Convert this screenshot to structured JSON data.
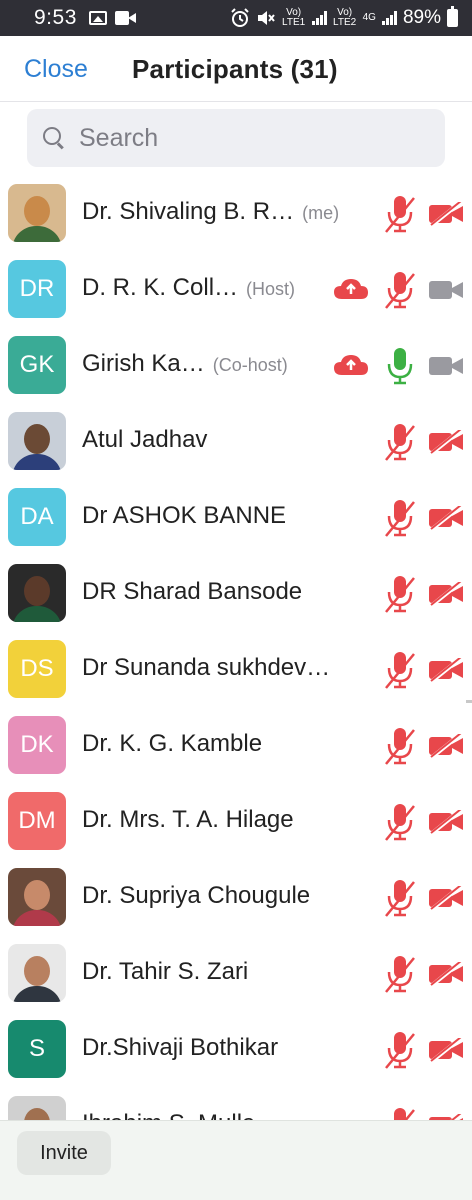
{
  "status_bar": {
    "time": "9:53",
    "network_1": "Vo) LTE1",
    "network_2": "Vo) LTE2",
    "network_type": "4G",
    "battery": "89%",
    "icons": [
      "gallery-icon",
      "video-camera-icon",
      "alarm-icon",
      "mute-icon",
      "signal-icon",
      "battery-icon"
    ]
  },
  "header": {
    "close_label": "Close",
    "title": "Participants (31)"
  },
  "search": {
    "placeholder": "Search"
  },
  "participants": [
    {
      "name": "Dr. Shivaling B. R…",
      "tag": "(me)",
      "avatar": "photo",
      "photo_colors": [
        "#c98a4a",
        "#3d6b3a",
        "#d8b98f"
      ],
      "cloud": false,
      "mic": "muted",
      "video": "off"
    },
    {
      "name": "D. R. K. Coll…",
      "tag": "(Host)",
      "avatar": "DR",
      "color": "#56c8e0",
      "cloud": true,
      "mic": "muted",
      "video": "on"
    },
    {
      "name": "Girish Ka…",
      "tag": "(Co-host)",
      "avatar": "GK",
      "color": "#3aab96",
      "cloud": true,
      "mic": "active",
      "video": "on"
    },
    {
      "name": "Atul Jadhav",
      "tag": "",
      "avatar": "photo",
      "photo_colors": [
        "#6b4a35",
        "#2c3f7a",
        "#c8cfd8"
      ],
      "cloud": false,
      "mic": "muted",
      "video": "off"
    },
    {
      "name": "Dr ASHOK BANNE",
      "tag": "",
      "avatar": "DA",
      "color": "#56c8e0",
      "cloud": false,
      "mic": "muted",
      "video": "off"
    },
    {
      "name": "DR Sharad Bansode",
      "tag": "",
      "avatar": "photo",
      "photo_colors": [
        "#5b3a2a",
        "#1f5a3a",
        "#2a2a2a"
      ],
      "cloud": false,
      "mic": "muted",
      "video": "off"
    },
    {
      "name": "Dr Sunanda sukhdev…",
      "tag": "",
      "avatar": "DS",
      "color": "#f2d13a",
      "cloud": false,
      "mic": "muted",
      "video": "off"
    },
    {
      "name": "Dr. K. G. Kamble",
      "tag": "",
      "avatar": "DK",
      "color": "#e78fb9",
      "cloud": false,
      "mic": "muted",
      "video": "off"
    },
    {
      "name": "Dr. Mrs. T. A. Hilage",
      "tag": "",
      "avatar": "DM",
      "color": "#f06a6a",
      "cloud": false,
      "mic": "muted",
      "video": "off"
    },
    {
      "name": "Dr. Supriya Chougule",
      "tag": "",
      "avatar": "photo",
      "photo_colors": [
        "#c78a6a",
        "#b03a4a",
        "#6a4a3a"
      ],
      "cloud": false,
      "mic": "muted",
      "video": "off"
    },
    {
      "name": "Dr. Tahir S. Zari",
      "tag": "",
      "avatar": "photo",
      "photo_colors": [
        "#b88060",
        "#2f3640",
        "#e8e8e8"
      ],
      "cloud": false,
      "mic": "muted",
      "video": "off"
    },
    {
      "name": "Dr.Shivaji Bothikar",
      "tag": "",
      "avatar": "S",
      "color": "#178a6e",
      "cloud": false,
      "mic": "muted",
      "video": "off"
    },
    {
      "name": "Ibrahim S. Mulla...",
      "tag": "",
      "avatar": "photo",
      "photo_colors": [
        "#a07050",
        "#3a3a48",
        "#d0d0d0"
      ],
      "cloud": false,
      "mic": "muted",
      "video": "off"
    }
  ],
  "footer": {
    "invite_label": "Invite"
  },
  "colors": {
    "accent": "#2d7fd3",
    "muted_red": "#e8474b",
    "active_green": "#3cb043",
    "video_on_grey": "#9a9aa0"
  }
}
